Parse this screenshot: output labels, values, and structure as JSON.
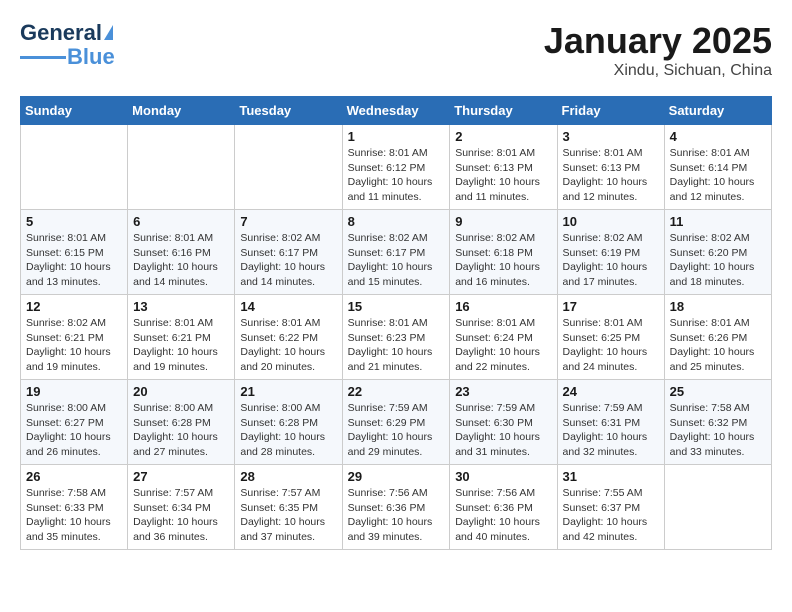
{
  "header": {
    "logo_general": "General",
    "logo_blue": "Blue",
    "title": "January 2025",
    "subtitle": "Xindu, Sichuan, China"
  },
  "days_of_week": [
    "Sunday",
    "Monday",
    "Tuesday",
    "Wednesday",
    "Thursday",
    "Friday",
    "Saturday"
  ],
  "weeks": [
    [
      {
        "num": "",
        "sunrise": "",
        "sunset": "",
        "daylight": ""
      },
      {
        "num": "",
        "sunrise": "",
        "sunset": "",
        "daylight": ""
      },
      {
        "num": "",
        "sunrise": "",
        "sunset": "",
        "daylight": ""
      },
      {
        "num": "1",
        "sunrise": "Sunrise: 8:01 AM",
        "sunset": "Sunset: 6:12 PM",
        "daylight": "Daylight: 10 hours and 11 minutes."
      },
      {
        "num": "2",
        "sunrise": "Sunrise: 8:01 AM",
        "sunset": "Sunset: 6:13 PM",
        "daylight": "Daylight: 10 hours and 11 minutes."
      },
      {
        "num": "3",
        "sunrise": "Sunrise: 8:01 AM",
        "sunset": "Sunset: 6:13 PM",
        "daylight": "Daylight: 10 hours and 12 minutes."
      },
      {
        "num": "4",
        "sunrise": "Sunrise: 8:01 AM",
        "sunset": "Sunset: 6:14 PM",
        "daylight": "Daylight: 10 hours and 12 minutes."
      }
    ],
    [
      {
        "num": "5",
        "sunrise": "Sunrise: 8:01 AM",
        "sunset": "Sunset: 6:15 PM",
        "daylight": "Daylight: 10 hours and 13 minutes."
      },
      {
        "num": "6",
        "sunrise": "Sunrise: 8:01 AM",
        "sunset": "Sunset: 6:16 PM",
        "daylight": "Daylight: 10 hours and 14 minutes."
      },
      {
        "num": "7",
        "sunrise": "Sunrise: 8:02 AM",
        "sunset": "Sunset: 6:17 PM",
        "daylight": "Daylight: 10 hours and 14 minutes."
      },
      {
        "num": "8",
        "sunrise": "Sunrise: 8:02 AM",
        "sunset": "Sunset: 6:17 PM",
        "daylight": "Daylight: 10 hours and 15 minutes."
      },
      {
        "num": "9",
        "sunrise": "Sunrise: 8:02 AM",
        "sunset": "Sunset: 6:18 PM",
        "daylight": "Daylight: 10 hours and 16 minutes."
      },
      {
        "num": "10",
        "sunrise": "Sunrise: 8:02 AM",
        "sunset": "Sunset: 6:19 PM",
        "daylight": "Daylight: 10 hours and 17 minutes."
      },
      {
        "num": "11",
        "sunrise": "Sunrise: 8:02 AM",
        "sunset": "Sunset: 6:20 PM",
        "daylight": "Daylight: 10 hours and 18 minutes."
      }
    ],
    [
      {
        "num": "12",
        "sunrise": "Sunrise: 8:02 AM",
        "sunset": "Sunset: 6:21 PM",
        "daylight": "Daylight: 10 hours and 19 minutes."
      },
      {
        "num": "13",
        "sunrise": "Sunrise: 8:01 AM",
        "sunset": "Sunset: 6:21 PM",
        "daylight": "Daylight: 10 hours and 19 minutes."
      },
      {
        "num": "14",
        "sunrise": "Sunrise: 8:01 AM",
        "sunset": "Sunset: 6:22 PM",
        "daylight": "Daylight: 10 hours and 20 minutes."
      },
      {
        "num": "15",
        "sunrise": "Sunrise: 8:01 AM",
        "sunset": "Sunset: 6:23 PM",
        "daylight": "Daylight: 10 hours and 21 minutes."
      },
      {
        "num": "16",
        "sunrise": "Sunrise: 8:01 AM",
        "sunset": "Sunset: 6:24 PM",
        "daylight": "Daylight: 10 hours and 22 minutes."
      },
      {
        "num": "17",
        "sunrise": "Sunrise: 8:01 AM",
        "sunset": "Sunset: 6:25 PM",
        "daylight": "Daylight: 10 hours and 24 minutes."
      },
      {
        "num": "18",
        "sunrise": "Sunrise: 8:01 AM",
        "sunset": "Sunset: 6:26 PM",
        "daylight": "Daylight: 10 hours and 25 minutes."
      }
    ],
    [
      {
        "num": "19",
        "sunrise": "Sunrise: 8:00 AM",
        "sunset": "Sunset: 6:27 PM",
        "daylight": "Daylight: 10 hours and 26 minutes."
      },
      {
        "num": "20",
        "sunrise": "Sunrise: 8:00 AM",
        "sunset": "Sunset: 6:28 PM",
        "daylight": "Daylight: 10 hours and 27 minutes."
      },
      {
        "num": "21",
        "sunrise": "Sunrise: 8:00 AM",
        "sunset": "Sunset: 6:28 PM",
        "daylight": "Daylight: 10 hours and 28 minutes."
      },
      {
        "num": "22",
        "sunrise": "Sunrise: 7:59 AM",
        "sunset": "Sunset: 6:29 PM",
        "daylight": "Daylight: 10 hours and 29 minutes."
      },
      {
        "num": "23",
        "sunrise": "Sunrise: 7:59 AM",
        "sunset": "Sunset: 6:30 PM",
        "daylight": "Daylight: 10 hours and 31 minutes."
      },
      {
        "num": "24",
        "sunrise": "Sunrise: 7:59 AM",
        "sunset": "Sunset: 6:31 PM",
        "daylight": "Daylight: 10 hours and 32 minutes."
      },
      {
        "num": "25",
        "sunrise": "Sunrise: 7:58 AM",
        "sunset": "Sunset: 6:32 PM",
        "daylight": "Daylight: 10 hours and 33 minutes."
      }
    ],
    [
      {
        "num": "26",
        "sunrise": "Sunrise: 7:58 AM",
        "sunset": "Sunset: 6:33 PM",
        "daylight": "Daylight: 10 hours and 35 minutes."
      },
      {
        "num": "27",
        "sunrise": "Sunrise: 7:57 AM",
        "sunset": "Sunset: 6:34 PM",
        "daylight": "Daylight: 10 hours and 36 minutes."
      },
      {
        "num": "28",
        "sunrise": "Sunrise: 7:57 AM",
        "sunset": "Sunset: 6:35 PM",
        "daylight": "Daylight: 10 hours and 37 minutes."
      },
      {
        "num": "29",
        "sunrise": "Sunrise: 7:56 AM",
        "sunset": "Sunset: 6:36 PM",
        "daylight": "Daylight: 10 hours and 39 minutes."
      },
      {
        "num": "30",
        "sunrise": "Sunrise: 7:56 AM",
        "sunset": "Sunset: 6:36 PM",
        "daylight": "Daylight: 10 hours and 40 minutes."
      },
      {
        "num": "31",
        "sunrise": "Sunrise: 7:55 AM",
        "sunset": "Sunset: 6:37 PM",
        "daylight": "Daylight: 10 hours and 42 minutes."
      },
      {
        "num": "",
        "sunrise": "",
        "sunset": "",
        "daylight": ""
      }
    ]
  ]
}
